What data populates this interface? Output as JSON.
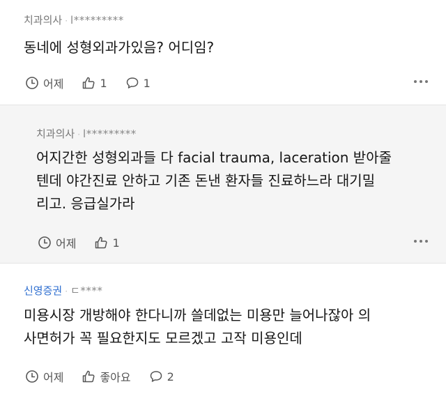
{
  "comments": [
    {
      "author": "치과의사",
      "separator": "·",
      "user_id": "l*********",
      "text": "동네에 성형외과가있음? 어디임?",
      "time": "어제",
      "like_count": "1",
      "reply_count": "1"
    },
    {
      "author": "치과의사",
      "separator": "·",
      "user_id": "l*********",
      "text_lines": [
        "어지간한 성형외과들 다 facial trauma, laceration 받아줄",
        "텐데 야간진료 안하고 기존 돈낸 환자들 진료하느라 대기밀",
        "리고. 응급실가라"
      ],
      "time": "어제",
      "like_count": "1"
    },
    {
      "author": "신영증권",
      "separator": "·",
      "user_id": "ㄷ****",
      "text_lines": [
        "미용시장 개방해야 한다니까 쓸데없는 미용만 늘어나잖아 의",
        "사면허가 꼭 필요한지도 모르겠고 고작 미용인데"
      ],
      "time": "어제",
      "like_label": "좋아요",
      "reply_count": "2"
    }
  ],
  "icons": {
    "clock": "clock-icon",
    "like": "thumbs-up-icon",
    "reply": "speech-bubble-icon",
    "more": "more-dots-icon"
  },
  "colors": {
    "author_highlight": "#2f6fd0",
    "reply_background": "#f5f5f5"
  }
}
